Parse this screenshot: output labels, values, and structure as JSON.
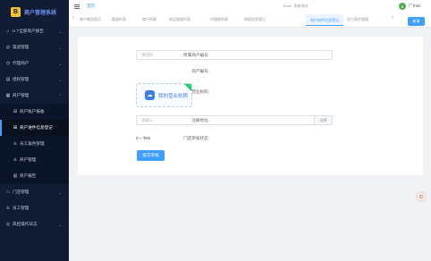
{
  "app": {
    "logo_char": "B",
    "title": "商户管理系统"
  },
  "sidebar": {
    "items": [
      {
        "icon": "⌂",
        "label": "H T全部商户报告",
        "arrow": "⌄"
      },
      {
        "icon": "◎",
        "label": "渠道管理",
        "arrow": "⌄"
      },
      {
        "icon": "◷",
        "label": "代理商户",
        "arrow": "⌄"
      },
      {
        "icon": "▤",
        "label": "授权管理",
        "arrow": "⌄"
      },
      {
        "icon": "▦",
        "label": "商户管理",
        "arrow": "⌃"
      },
      {
        "icon": "⊞",
        "label": "商户账户报备",
        "sub": true
      },
      {
        "icon": "⊞",
        "label": "商户进件信息登记",
        "sub": true,
        "active": true
      },
      {
        "icon": "♙",
        "label": "员工角色管理",
        "sub": true
      },
      {
        "icon": "♙",
        "label": "商户管理",
        "sub": true
      },
      {
        "icon": "▥",
        "label": "商户报告",
        "sub": true
      },
      {
        "icon": "♘",
        "label": "门店管理",
        "arrow": "⌄"
      },
      {
        "icon": "♙",
        "label": "员工管理",
        "arrow": ""
      },
      {
        "icon": "◎",
        "label": "风控操作日志",
        "arrow": "⌄"
      }
    ]
  },
  "header": {
    "home": "首页",
    "center_text": "Beta · 系统测试",
    "avatar_char": "B",
    "user": "广州ab"
  },
  "tags": {
    "items": [
      "商户概览首页",
      "渠道列表",
      "商户列表",
      "商品管理列表",
      "代理商列表",
      "授权信息登记",
      "商户进件信息登记",
      "员工角色管理"
    ],
    "active_index": 6,
    "left_arrow": "‹",
    "right_arrow": "›",
    "button": "新增"
  },
  "form": {
    "merchant_label": "所属商户编号:",
    "merchant_placeholder": "请选择",
    "merchant_dd": "⌄",
    "number_label": "商户编号:",
    "image_label": "营业执照:",
    "upload_text": "我的营业执照",
    "upload_check": "✓",
    "reg_label": "注册地址:",
    "reg_placeholder": "请输入",
    "reg_append": "选择",
    "status_label": "门店审核状态:",
    "status_value": "0 = Tom",
    "submit": "提交审核"
  },
  "colors": {
    "accent": "#409eff",
    "sidebar_bg": "#0f1c34"
  }
}
